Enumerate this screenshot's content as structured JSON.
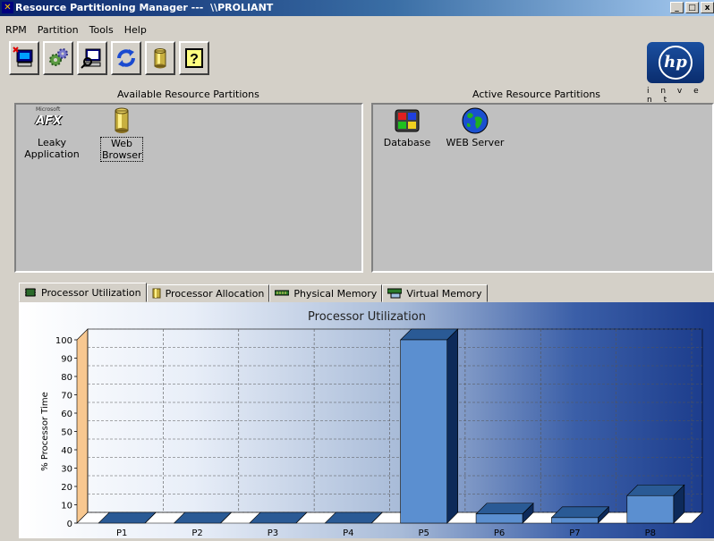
{
  "window": {
    "title": "Resource Partitioning Manager ---  \\\\PROLIANT",
    "minimize_label": "_",
    "maximize_label": "□",
    "close_label": "x"
  },
  "menu": [
    "RPM",
    "Partition",
    "Tools",
    "Help"
  ],
  "toolbar": {
    "buttons": [
      "computer-x-icon",
      "gears-icon",
      "search-monitor-icon",
      "refresh-icon",
      "cylinder-icon",
      "help-icon"
    ],
    "help_glyph": "?"
  },
  "brand": {
    "logo_text": "hp",
    "tagline": "i n v e n t"
  },
  "available": {
    "header": "Available Resource Partitions",
    "items": [
      {
        "label1": "Leaky",
        "label2": "Application",
        "icon": "afx-icon",
        "icon_caption": "Microsoft",
        "icon_text": "AFX"
      },
      {
        "label1": "Web",
        "label2": "Browser",
        "icon": "cylinder-icon"
      }
    ]
  },
  "active": {
    "header": "Active Resource Partitions",
    "items": [
      {
        "label": "Database",
        "icon": "database-icon"
      },
      {
        "label": "WEB Server",
        "icon": "globe-icon"
      }
    ]
  },
  "tabs": [
    {
      "label": "Processor Utilization",
      "icon": "chip-icon",
      "active": true
    },
    {
      "label": "Processor Allocation",
      "icon": "cylinder-icon",
      "active": false
    },
    {
      "label": "Physical Memory",
      "icon": "memory-icon",
      "active": false
    },
    {
      "label": "Virtual Memory",
      "icon": "memory-disk-icon",
      "active": false
    }
  ],
  "chart_data": {
    "type": "bar",
    "title": "Processor Utilization",
    "xlabel": "",
    "ylabel": "% Processor Time",
    "categories": [
      "P1",
      "P2",
      "P3",
      "P4",
      "P5",
      "P6",
      "P7",
      "P8"
    ],
    "values": [
      0,
      0,
      0,
      0,
      100,
      5,
      3,
      15
    ],
    "ylim": [
      0,
      100
    ],
    "yticks": [
      0,
      10,
      20,
      30,
      40,
      50,
      60,
      70,
      80,
      90,
      100
    ],
    "grid": true,
    "colors": {
      "bar_front": "#5b8fd0",
      "bar_top": "#2a5a95",
      "bar_side": "#0d2a5a",
      "wall": "#f8c890"
    }
  }
}
